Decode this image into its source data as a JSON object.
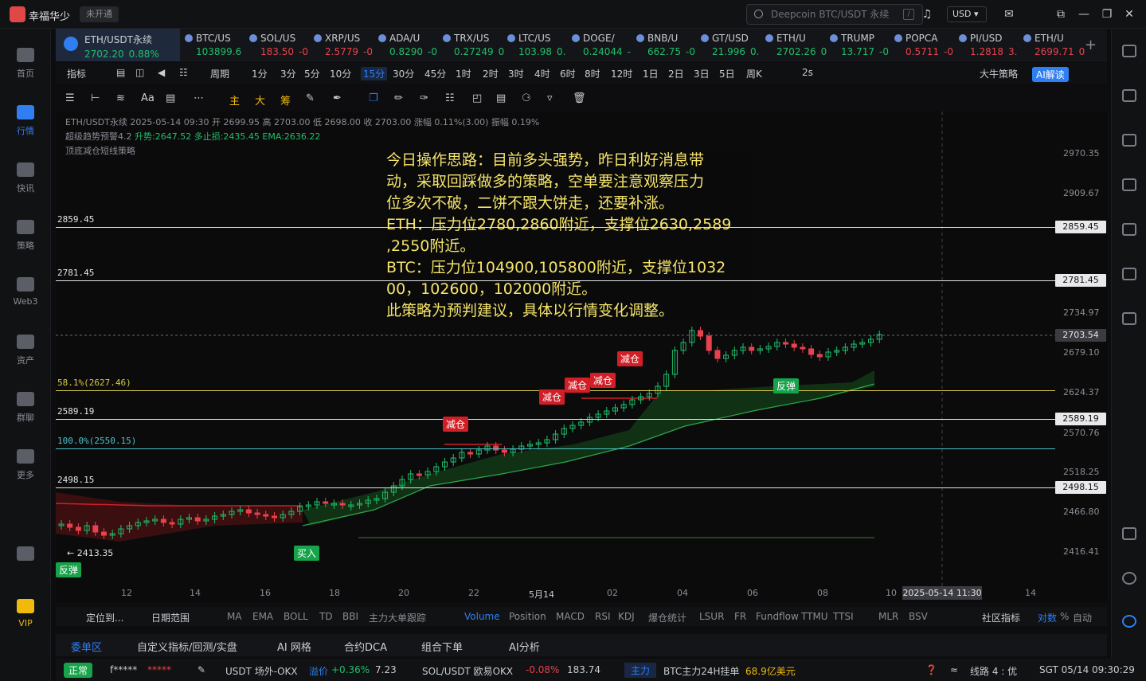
{
  "app": {
    "name": "幸福华少",
    "login_badge": "未开通",
    "search_placeholder": "Deepcoin BTC/USDT 永续",
    "search_shortcut": "/",
    "currency": "USD"
  },
  "nav": [
    {
      "label": "首页"
    },
    {
      "label": "行情",
      "active": true
    },
    {
      "label": "快讯"
    },
    {
      "label": "策略"
    },
    {
      "label": "Web3"
    },
    {
      "label": "资产"
    },
    {
      "label": "群聊"
    },
    {
      "label": "更多"
    },
    {
      "label": ""
    },
    {
      "label": "VIP"
    }
  ],
  "tickers": [
    {
      "sym": "ETH/USDT永续",
      "price": "2702.20",
      "chg": "0.88%",
      "up": true,
      "active": true
    },
    {
      "sym": "BTC/US",
      "price": "103899.6",
      "chg": "",
      "up": true
    },
    {
      "sym": "SOL/US",
      "price": "183.50",
      "chg": "-0",
      "up": false
    },
    {
      "sym": "XRP/US",
      "price": "2.5779",
      "chg": "-0",
      "up": false
    },
    {
      "sym": "ADA/U",
      "price": "0.8290",
      "chg": "-0",
      "up": true
    },
    {
      "sym": "TRX/US",
      "price": "0.27249",
      "chg": "0",
      "up": true
    },
    {
      "sym": "LTC/US",
      "price": "103.98",
      "chg": "0.",
      "up": true
    },
    {
      "sym": "DOGE/",
      "price": "0.24044",
      "chg": "-",
      "up": true
    },
    {
      "sym": "BNB/U",
      "price": "662.75",
      "chg": "-0",
      "up": true
    },
    {
      "sym": "GT/USD",
      "price": "21.996",
      "chg": "0.",
      "up": true
    },
    {
      "sym": "ETH/U",
      "price": "2702.26",
      "chg": "0",
      "up": true
    },
    {
      "sym": "TRUMP",
      "price": "13.717",
      "chg": "-0",
      "up": true
    },
    {
      "sym": "POPCA",
      "price": "0.5711",
      "chg": "-0",
      "up": false
    },
    {
      "sym": "PI/USD",
      "price": "1.2818",
      "chg": "3.",
      "up": false
    },
    {
      "sym": "ETH/U",
      "price": "2699.71",
      "chg": "0",
      "up": false
    }
  ],
  "timeframes": [
    "指标",
    "周期",
    "1分",
    "3分",
    "5分",
    "10分",
    "15分",
    "30分",
    "45分",
    "1时",
    "2时",
    "3时",
    "4时",
    "6时",
    "8时",
    "12时",
    "1日",
    "2日",
    "3日",
    "5日",
    "周K"
  ],
  "tf_selected": "15分",
  "toolbar_right": {
    "refresh": "2s",
    "strategy": "大牛策略",
    "ai": "AI解读"
  },
  "draw_tools": [
    "主",
    "大",
    "筹"
  ],
  "info": {
    "line1": "ETH/USDT永续 2025-05-14 09:30 开 2699.95 高 2703.00 低 2698.00 收 2703.00 涨幅 0.11%(3.00) 振幅 0.19%",
    "line2a": "超级趋势预警4.2",
    "line2b": "升势:2647.52 多止损:2435.45 EMA:2636.22",
    "line3": "顶底减仓短线策略"
  },
  "annotation": [
    "今日操作思路：目前多头强势，昨日利好消息带",
    "动，采取回踩做多的策略，空单要注意观察压力",
    "位多次不破，二饼不跟大饼走，还要补涨。",
    "ETH：压力位2780,2860附近，支撑位2630,2589",
    ",2550附近。",
    "BTC：压力位104900,105800附近，支撑位1032",
    "00，102600，102000附近。",
    "此策略为预判建议，具体以行情变化调整。"
  ],
  "yaxis": [
    "2970.35",
    "2909.67",
    "2859.45",
    "2781.45",
    "2734.97",
    "2703.54",
    "2679.10",
    "2624.37",
    "2589.19",
    "2570.76",
    "2518.25",
    "2498.15",
    "2466.80",
    "2416.41"
  ],
  "hlines": [
    {
      "label": "2859.45",
      "tag": "2859.45"
    },
    {
      "label": "2781.45",
      "tag": "2781.45"
    },
    {
      "label": "58.1%(2627.46)"
    },
    {
      "label": "2589.19",
      "tag": "2589.19"
    },
    {
      "label": "100.0%(2550.15)"
    },
    {
      "label": "2498.15",
      "tag": "2498.15"
    }
  ],
  "low_label": "2413.35",
  "signals": {
    "rebound": "反弹",
    "buy": "买入",
    "reduce": "减仓",
    "rebound2": "反弹"
  },
  "xaxis": [
    "12",
    "14",
    "16",
    "18",
    "20",
    "22",
    "5月14",
    "02",
    "04",
    "06",
    "08",
    "10",
    "14"
  ],
  "x_cursor": "2025-05-14 11:30",
  "indicator_bar": {
    "locate": "定位到...",
    "range": "日期范围",
    "items": [
      "MA",
      "EMA",
      "BOLL",
      "TD",
      "BBI",
      "主力大单跟踪",
      "Volume",
      "Position",
      "MACD",
      "RSI",
      "KDJ",
      "爆仓统计",
      "LSUR",
      "FR",
      "Fundflow",
      "TTMU",
      "TTSI",
      "MLR",
      "BSV"
    ],
    "selected": "Volume",
    "community": "社区指标",
    "compare": "对数",
    "pct": "%",
    "auto": "自动"
  },
  "bottom_tabs": [
    "委单区",
    "自定义指标/回测/实盘",
    "AI 网格",
    "合约DCA",
    "组合下单",
    "AI分析"
  ],
  "status": {
    "state": "正常",
    "user": "f*****",
    "mask": "*****",
    "usdt": "USDT 场外-OKX",
    "premium_label": "溢价",
    "premium": "+0.36%",
    "premium_val": "7.23",
    "sol": "SOL/USDT 欧易OKX",
    "sol_chg": "-0.08%",
    "sol_price": "183.74",
    "main": "主力",
    "btc_main": "BTC主力24H挂单",
    "btc_val": "68.9亿美元",
    "line": "线路 4 : 优",
    "time": "SGT 05/14 09:30:29"
  }
}
